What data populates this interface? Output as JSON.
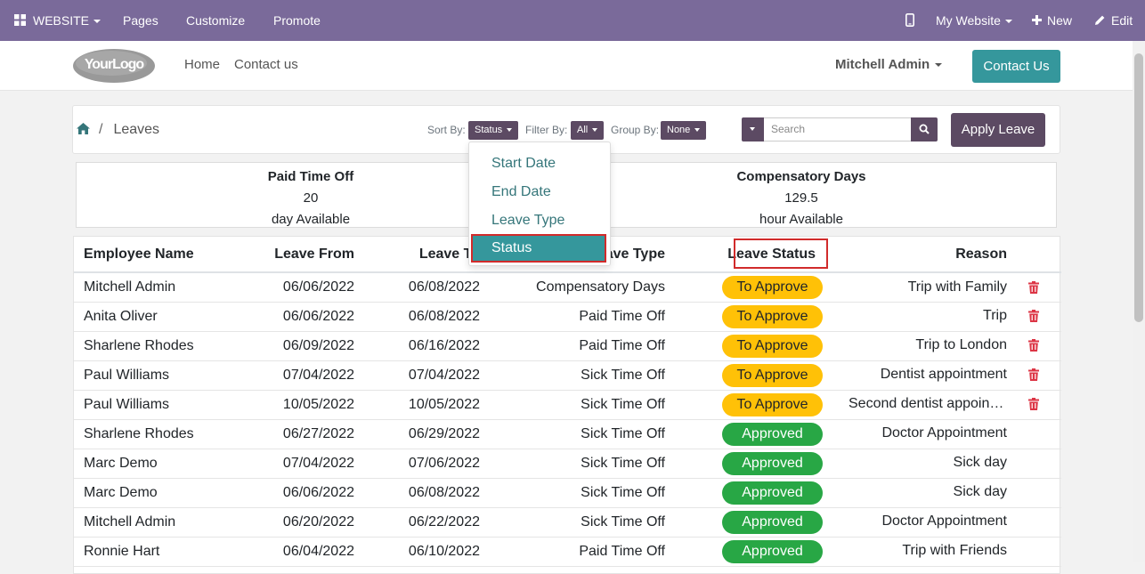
{
  "topbar": {
    "website_menu": "WEBSITE",
    "pages": "Pages",
    "customize": "Customize",
    "promote": "Promote",
    "my_website": "My Website",
    "new": "New",
    "edit": "Edit",
    "background_color": "#7a6a9a"
  },
  "header": {
    "logo_text": "YourLogo",
    "nav": [
      "Home",
      "Contact us"
    ],
    "user": "Mitchell Admin",
    "contact_button": "Contact Us"
  },
  "toolbar": {
    "breadcrumb_current": "Leaves",
    "sort_label": "Sort By:",
    "sort_value": "Status",
    "filter_label": "Filter By:",
    "filter_value": "All",
    "group_label": "Group By:",
    "group_value": "None",
    "search_placeholder": "Search",
    "apply_button": "Apply Leave"
  },
  "sort_dropdown": {
    "options": [
      "Start Date",
      "End Date",
      "Leave Type",
      "Status"
    ],
    "selected": "Status"
  },
  "summary": [
    {
      "title": "Paid Time Off",
      "value": "20",
      "unit": "day Available"
    },
    {
      "title": "Compensatory Days",
      "value": "129.5",
      "unit": "hour Available"
    }
  ],
  "table": {
    "columns": [
      "Employee Name",
      "Leave From",
      "Leave To",
      "Leave Type",
      "Leave Status",
      "Reason"
    ],
    "rows": [
      {
        "name": "Mitchell Admin",
        "from": "06/06/2022",
        "to": "06/08/2022",
        "type": "Compensatory Days",
        "status": "To Approve",
        "reason": "Trip with Family"
      },
      {
        "name": "Anita Oliver",
        "from": "06/06/2022",
        "to": "06/08/2022",
        "type": "Paid Time Off",
        "status": "To Approve",
        "reason": "Trip"
      },
      {
        "name": "Sharlene Rhodes",
        "from": "06/09/2022",
        "to": "06/16/2022",
        "type": "Paid Time Off",
        "status": "To Approve",
        "reason": "Trip to London"
      },
      {
        "name": "Paul Williams",
        "from": "07/04/2022",
        "to": "07/04/2022",
        "type": "Sick Time Off",
        "status": "To Approve",
        "reason": "Dentist appointment"
      },
      {
        "name": "Paul Williams",
        "from": "10/05/2022",
        "to": "10/05/2022",
        "type": "Sick Time Off",
        "status": "To Approve",
        "reason": "Second dentist appoint…"
      },
      {
        "name": "Sharlene Rhodes",
        "from": "06/27/2022",
        "to": "06/29/2022",
        "type": "Sick Time Off",
        "status": "Approved",
        "reason": "Doctor Appointment"
      },
      {
        "name": "Marc Demo",
        "from": "07/04/2022",
        "to": "07/06/2022",
        "type": "Sick Time Off",
        "status": "Approved",
        "reason": "Sick day"
      },
      {
        "name": "Marc Demo",
        "from": "06/06/2022",
        "to": "06/08/2022",
        "type": "Sick Time Off",
        "status": "Approved",
        "reason": "Sick day"
      },
      {
        "name": "Mitchell Admin",
        "from": "06/20/2022",
        "to": "06/22/2022",
        "type": "Sick Time Off",
        "status": "Approved",
        "reason": "Doctor Appointment"
      },
      {
        "name": "Ronnie Hart",
        "from": "06/04/2022",
        "to": "06/10/2022",
        "type": "Paid Time Off",
        "status": "Approved",
        "reason": "Trip with Friends"
      }
    ]
  },
  "colors": {
    "accent": "#35979c",
    "primary": "#5c4a63",
    "to_approve": "#ffc107",
    "approved": "#28a745",
    "delete": "#dc3545",
    "highlight": "#d12b2b"
  }
}
